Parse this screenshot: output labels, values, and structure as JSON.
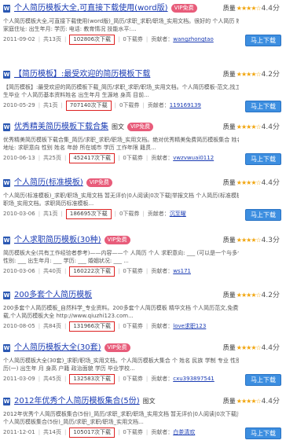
{
  "labels": {
    "quality": "质量",
    "score_suffix": "分",
    "download_btn": "马上下载",
    "vip": "VIP免费",
    "pages_prefix": "共",
    "pages_suffix": "页",
    "download_coupon": "下载券",
    "uploader_prefix": "贡献者："
  },
  "items": [
    {
      "title": "个人简历模板大全,可直接下载使用(word版)",
      "tag": "",
      "vip": true,
      "score": "4.4",
      "desc1": "个人简历模板大全,可直接下载使用(word版)_简历/求职_求职/职场_实用文档。很好的 个人简历 姓 名: E-mail:",
      "desc2": "家庭住址: 出生年月: 学历: 电话: 教育情况 技能水平:...",
      "date": "2011-09-02",
      "pages": "13",
      "downloads": "102806次下载",
      "coupon": "0",
      "uploader": "wangzhongtao",
      "has_button": true
    },
    {
      "title": "【简历模板】:最受欢迎的简历模板下载",
      "tag": "",
      "vip": false,
      "score": "4.2",
      "desc1": "【简历模板】:最受欢迎的简历模板下载_简历/求职_求职/职场_实用文档。个人简历模板-范文,找工作应聘,大学生,应届",
      "desc2": "生毕业 个人简历基本资料姓名 出生年月 生源地 身高 目前...",
      "date": "2010-05-29",
      "pages": "1",
      "downloads": "707140次下载",
      "coupon": "0",
      "uploader": "119169139",
      "has_button": true
    },
    {
      "title": "优秀精美简历模板下载合集",
      "tag": "图文",
      "vip": true,
      "score": "4.4",
      "desc1": "优秀精美简历模板下载合集_简历/求职_求职/职场_实用文档。绝对优秀精美免费简历模板集合 姓名 E_mail 联系电话",
      "desc2": "地址: 求职意向 性别 姓名 年龄 所在城市 学历 工作年限 籍贯...",
      "date": "2010-06-13",
      "pages": "25",
      "downloads": "452417次下载",
      "coupon": "0",
      "uploader": "vwzvwuai0112",
      "has_button": true
    },
    {
      "title": "个人简历(标准模板)",
      "tag": "",
      "vip": true,
      "score": "4.4",
      "desc1": "个人简历(标准模板)_求职/职场_实用文档 暂无评价|0人阅读|0次下载|举报文档 个人简历(标准模板)_求职/",
      "desc2": "职场_实用文档。求职简历标准模板...",
      "date": "2010-03-06",
      "pages": "1",
      "downloads": "186695次下载",
      "coupon": "0",
      "uploader": "沉至曜",
      "has_button": true
    },
    {
      "title": "个人求职简历模板(30种)",
      "tag": "",
      "vip": true,
      "score": "4.3",
      "desc1": "简历模板大全(共有工作经验者参考)——内容——个 人简历 个人 求职意向: ___ (可以是一个与多个)",
      "desc2": "性别: ___ 出生年月: ___ 学历: ___ 婚姻状况: ___ ...",
      "date": "2010-03-06",
      "pages": "40",
      "downloads": "160222次下载",
      "coupon": "0",
      "uploader": "ws171",
      "has_button": false
    },
    {
      "title": "200多套个人简历模板",
      "tag": "",
      "vip": false,
      "score": "4.2",
      "desc1": "200多套个人简历模板_自然科学_专业资料。200多套个人简历模板 精华文档 个人简历范文,免费简历模板下",
      "desc2": "载,个人简历模板大全 http://www.qiuzhi123.com...",
      "date": "2010-08-05",
      "pages": "84",
      "downloads": "131966次下载",
      "coupon": "0",
      "uploader": "love求职123",
      "has_button": false
    },
    {
      "title": "个人简历模板大全(30套)",
      "tag": "",
      "vip": true,
      "score": "4.4",
      "desc1": "个人简历模板大全(30套)_求职/职场_实用文档。个人简历模板大集合 个 姓名 民族 学制 专业 性别 个人 简",
      "desc2": "历(一) 出生年 月 身高 户籍 政治面貌 学历 毕业学校...",
      "date": "2011-03-09",
      "pages": "45",
      "downloads": "132583次下载",
      "coupon": "0",
      "uploader": "cxu393897541",
      "has_button": true
    },
    {
      "title": "2012年优秀个人简历模板集合(5份)",
      "tag": "图文",
      "vip": false,
      "score": "4.4",
      "desc1": "2012年优秀个人简历模板集合(5份)_简历/求职_求职/职场_实用文档 暂无评价|0人阅读|0次下载|举报文档2012年优秀",
      "desc2": "个人简历模板集合(5份)_简历/求职_求职/职场_实用文档...",
      "date": "2011-12-01",
      "pages": "14",
      "downloads": "105017次下载",
      "coupon": "0",
      "uploader": "白茶清欢",
      "has_button": true
    }
  ]
}
